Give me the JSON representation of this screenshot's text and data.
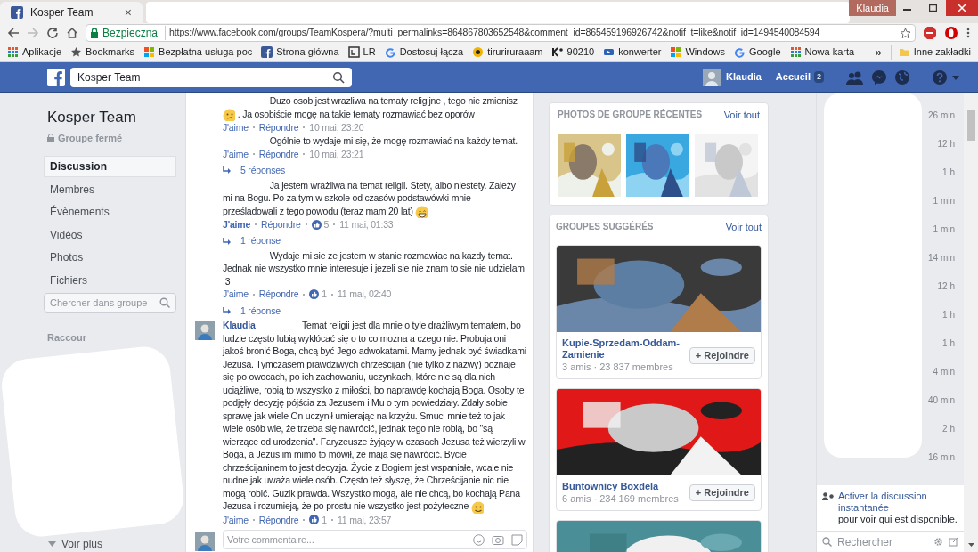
{
  "browser": {
    "tab": {
      "title": "Kosper Team",
      "close": "×"
    },
    "profile": "Klaudia",
    "security": "Bezpieczna",
    "url": "https://www.facebook.com/groups/TeamKospera/?multi_permalinks=864867803652548&comment_id=865459196926742&notif_t=like&notif_id=1494540084594",
    "bookmarks": [
      {
        "label": "Aplikacje",
        "kind": "apps"
      },
      {
        "label": "Bookmarks",
        "kind": "star"
      },
      {
        "label": "Bezpłatna usługa poc",
        "kind": "windows"
      },
      {
        "label": "Strona główna",
        "kind": "fb"
      },
      {
        "label": "LR",
        "kind": "lr"
      },
      {
        "label": "Dostosuj łącza",
        "kind": "google"
      },
      {
        "label": "tiruriruraaam",
        "kind": "ring"
      },
      {
        "label": "90210",
        "kind": "k"
      },
      {
        "label": "konwerter",
        "kind": "yt"
      },
      {
        "label": "Windows",
        "kind": "windows"
      },
      {
        "label": "Google",
        "kind": "google"
      },
      {
        "label": "Nowa karta",
        "kind": "apps"
      }
    ],
    "more": "»",
    "other_bookmarks": "Inne zakładki"
  },
  "topbar": {
    "search_value": "Kosper Team",
    "user": "Klaudia",
    "home": "Accueil",
    "home_badge": "2"
  },
  "group": {
    "name": "Kosper Team",
    "privacy": "Groupe fermé",
    "nav": [
      {
        "label": "Discussion",
        "selected": true
      },
      {
        "label": "Membres",
        "selected": false
      },
      {
        "label": "Évènements",
        "selected": false
      },
      {
        "label": "Vidéos",
        "selected": false
      },
      {
        "label": "Photos",
        "selected": false
      },
      {
        "label": "Fichiers",
        "selected": false
      }
    ],
    "search_placeholder": "Chercher dans groupe",
    "shortcuts_heading": "Raccour",
    "see_more": "Voir plus"
  },
  "comments": [
    {
      "parts": [
        {
          "kind": "text",
          "text": "Duzo osob jest wrazliwa na tematy religijne , tego nie zmienisz "
        },
        {
          "kind": "confused_emoji"
        },
        {
          "kind": "text",
          "text": " . Ja osobiście mogę na takie tematy rozmawiać bez oporów"
        }
      ],
      "like": "J'aime",
      "liked": false,
      "reply": "Répondre",
      "time": "10 mai, 23:20"
    },
    {
      "parts": [
        {
          "kind": "text",
          "text": "Ogólnie to wydaje mi się, że mogę rozmawiać na każdy temat."
        }
      ],
      "like": "J'aime",
      "liked": false,
      "reply": "Répondre",
      "time": "10 mai, 23:21",
      "replies": "5 réponses"
    },
    {
      "parts": [
        {
          "kind": "text",
          "text": "Ja jestem wrażliwa na temat religii. Stety, albo niestety. Zależy mi na Bogu. Po za tym w szkole od czasów podstawówki mnie prześladowali z tego powodu (teraz mam 20 lat) "
        },
        {
          "kind": "grin_emoji"
        }
      ],
      "like": "J'aime",
      "liked": true,
      "reply": "Répondre",
      "reactions": "5",
      "time": "11 mai, 01:33",
      "replies": "1 réponse"
    },
    {
      "parts": [
        {
          "kind": "text",
          "text": "Wydaje mi sie ze jestem w stanie rozmawiac na kazdy temat. Jednak nie wszystko mnie interesuje i jezeli sie nie znam to sie nie udzielam ;3"
        }
      ],
      "like": "J'aime",
      "liked": false,
      "reply": "Répondre",
      "reactions": "1",
      "time": "11 mai, 02:40",
      "replies": "1 réponse"
    },
    {
      "author": "Klaudia",
      "parts": [
        {
          "kind": "text",
          "text": "Temat religii jest dla mnie o tyle drażliwym tematem, bo ludzie często lubią wykłócać się o to co można a czego nie. Probuja oni jakoś bronić Boga, chcą być Jego adwokatami. Mamy jednak być świadkami Jezusa. Tymczasem prawdziwych chrześcijan (nie tylko z nazwy) poznaje się po owocach, po ich zachowaniu, uczynkach, które nie są dla nich uciążliwe, robią to wszystko z miłości, bo naprawdę kochają Boga. Osoby te podjęły decyzję pójścia za Jezusem i Mu o tym powiedziały. Zdały sobie sprawę jak wiele On uczynił umierając na krzyżu. Smuci mnie też to jak wiele osób wie, że trzeba się nawrócić, jednak tego nie robią, bo \"są wierzące od urodzenia\". Faryzeusze żyjący w czasach Jezusa też wierzyli w Boga, a Jezus im mimo to mówił, że mają się nawrócić. Bycie chrześcijaninem to jest decyzja. Życie z Bogiem jest wspaniałe, wcale nie nudne jak uważa wiele osób. Często też słyszę, że Chrześcijanie nic nie mogą robić. Guzik prawda. Wszystko mogą, ale nie chcą, bo kochają Pana Jezusa i rozumieją, że po prostu nie wszystko jest pożyteczne "
        },
        {
          "kind": "smile_emoji"
        }
      ],
      "like": "J'aime",
      "liked": false,
      "reply": "Répondre",
      "reactions": "1",
      "time": "11 mai, 23:57"
    }
  ],
  "comment_placeholder": "Votre commentaire...",
  "recent_photos": {
    "title": "PHOTOS DE GROUPE RÉCENTES",
    "see_all": "Voir tout",
    "photos": [
      {
        "kind": "picture"
      },
      {
        "kind": "picture"
      },
      {
        "kind": "picture"
      }
    ]
  },
  "suggested_groups": {
    "title": "GROUPES SUGGÉRÉS",
    "see_all": "Voir tout",
    "groups": [
      {
        "name": "Kupie-Sprzedam-Oddam-Zamienie",
        "meta": "3 amis · 23 837 membres",
        "join": "+ Rejoindre"
      },
      {
        "name": "Buntownicy Boxdela",
        "meta": "6 amis · 234 169 membres",
        "join": "+ Rejoindre"
      },
      {
        "kind": "picture"
      }
    ]
  },
  "chat": {
    "times": [
      "26 min",
      "12 h",
      "1 h",
      "1 min",
      "1 min",
      "14 min",
      "12 h",
      "1 h",
      "1 h",
      "4 min",
      "40 min",
      "2 h",
      "16 min"
    ],
    "activate_link": "Activer la discussion instantanée",
    "activate_rest": "pour voir qui est disponible.",
    "search_placeholder": "Rechercher"
  }
}
